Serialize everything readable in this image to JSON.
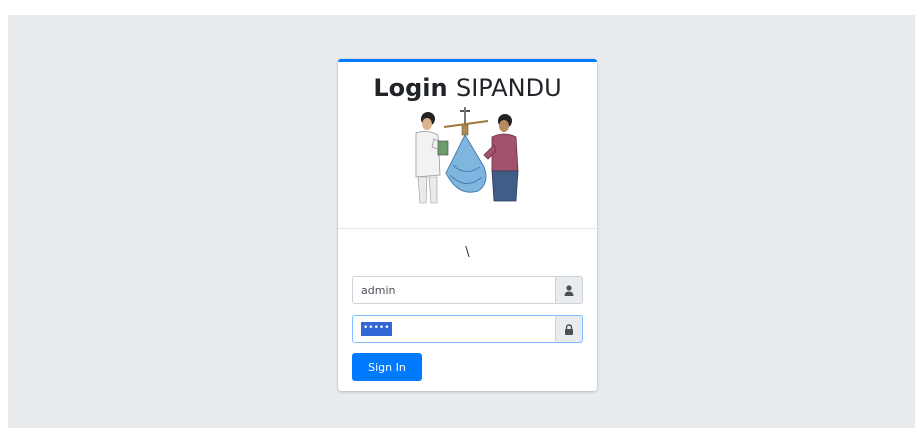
{
  "header": {
    "title_bold": "Login",
    "title_rest": "SIPANDU"
  },
  "body": {
    "stray_text": "\\",
    "username": {
      "value": "admin",
      "icon": "user-icon"
    },
    "password": {
      "masked_value": "•••••",
      "icon": "lock-icon"
    },
    "sign_in_label": "Sign In"
  },
  "colors": {
    "accent": "#007bff",
    "background": "#e9ecef",
    "selection": "#3367d6"
  }
}
